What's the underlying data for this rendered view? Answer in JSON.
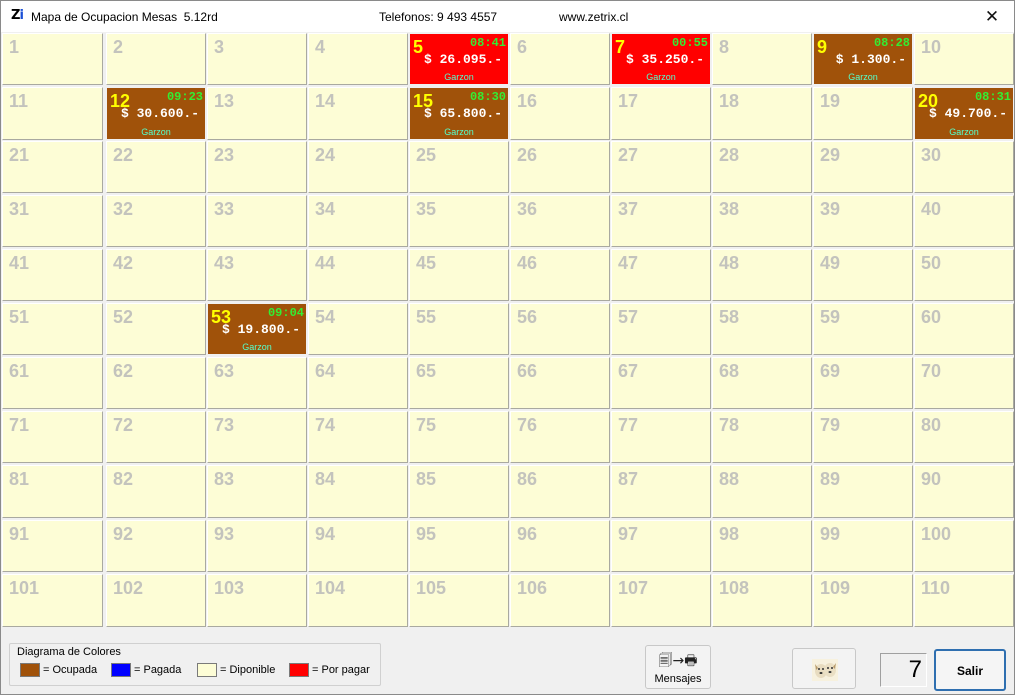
{
  "window": {
    "app_icon": "zi-logo-icon",
    "title": "Mapa de Ocupacion Mesas  5.12rd",
    "phones": "Telefonos: 9 493 4557",
    "website": "www.zetrix.cl",
    "close_glyph": "✕"
  },
  "tables": [
    {
      "num": "1"
    },
    {
      "num": "2"
    },
    {
      "num": "3"
    },
    {
      "num": "4"
    },
    {
      "num": "5",
      "status": "porpagar",
      "time": "08:41",
      "amount": "$ 26.095.-",
      "waiter": "Garzon"
    },
    {
      "num": "6"
    },
    {
      "num": "7",
      "status": "porpagar",
      "time": "00:55",
      "amount": "$ 35.250.-",
      "waiter": "Garzon"
    },
    {
      "num": "8"
    },
    {
      "num": "9",
      "status": "ocupada",
      "time": "08:28",
      "amount": "$ 1.300.-",
      "waiter": "Garzon"
    },
    {
      "num": "10"
    },
    {
      "num": "11"
    },
    {
      "num": "12",
      "status": "ocupada",
      "time": "09:23",
      "amount": "$ 30.600.-",
      "waiter": "Garzon"
    },
    {
      "num": "13"
    },
    {
      "num": "14"
    },
    {
      "num": "15",
      "status": "ocupada",
      "time": "08:30",
      "amount": "$ 65.800.-",
      "waiter": "Garzon"
    },
    {
      "num": "16"
    },
    {
      "num": "17"
    },
    {
      "num": "18"
    },
    {
      "num": "19"
    },
    {
      "num": "20",
      "status": "ocupada",
      "time": "08:31",
      "amount": "$ 49.700.-",
      "waiter": "Garzon"
    },
    {
      "num": "21"
    },
    {
      "num": "22"
    },
    {
      "num": "23"
    },
    {
      "num": "24"
    },
    {
      "num": "25"
    },
    {
      "num": "26"
    },
    {
      "num": "27"
    },
    {
      "num": "28"
    },
    {
      "num": "29"
    },
    {
      "num": "30"
    },
    {
      "num": "31"
    },
    {
      "num": "32"
    },
    {
      "num": "33"
    },
    {
      "num": "34"
    },
    {
      "num": "35"
    },
    {
      "num": "36"
    },
    {
      "num": "37"
    },
    {
      "num": "38"
    },
    {
      "num": "39"
    },
    {
      "num": "40"
    },
    {
      "num": "41"
    },
    {
      "num": "42"
    },
    {
      "num": "43"
    },
    {
      "num": "44"
    },
    {
      "num": "45"
    },
    {
      "num": "46"
    },
    {
      "num": "47"
    },
    {
      "num": "48"
    },
    {
      "num": "49"
    },
    {
      "num": "50"
    },
    {
      "num": "51"
    },
    {
      "num": "52"
    },
    {
      "num": "53",
      "status": "ocupada",
      "time": "09:04",
      "amount": "$ 19.800.-",
      "waiter": "Garzon"
    },
    {
      "num": "54"
    },
    {
      "num": "55"
    },
    {
      "num": "56"
    },
    {
      "num": "57"
    },
    {
      "num": "58"
    },
    {
      "num": "59"
    },
    {
      "num": "60"
    },
    {
      "num": "61"
    },
    {
      "num": "62"
    },
    {
      "num": "63"
    },
    {
      "num": "64"
    },
    {
      "num": "65"
    },
    {
      "num": "66"
    },
    {
      "num": "67"
    },
    {
      "num": "68"
    },
    {
      "num": "69"
    },
    {
      "num": "70"
    },
    {
      "num": "71"
    },
    {
      "num": "72"
    },
    {
      "num": "73"
    },
    {
      "num": "74"
    },
    {
      "num": "75"
    },
    {
      "num": "76"
    },
    {
      "num": "77"
    },
    {
      "num": "78"
    },
    {
      "num": "79"
    },
    {
      "num": "80"
    },
    {
      "num": "81"
    },
    {
      "num": "82"
    },
    {
      "num": "83"
    },
    {
      "num": "84"
    },
    {
      "num": "85"
    },
    {
      "num": "86"
    },
    {
      "num": "87"
    },
    {
      "num": "88"
    },
    {
      "num": "89"
    },
    {
      "num": "90"
    },
    {
      "num": "91"
    },
    {
      "num": "92"
    },
    {
      "num": "93"
    },
    {
      "num": "94"
    },
    {
      "num": "95"
    },
    {
      "num": "96"
    },
    {
      "num": "97"
    },
    {
      "num": "98"
    },
    {
      "num": "99"
    },
    {
      "num": "100"
    },
    {
      "num": "101"
    },
    {
      "num": "102"
    },
    {
      "num": "103"
    },
    {
      "num": "104"
    },
    {
      "num": "105"
    },
    {
      "num": "106"
    },
    {
      "num": "107"
    },
    {
      "num": "108"
    },
    {
      "num": "109"
    },
    {
      "num": "110"
    }
  ],
  "legend": {
    "title": "Diagrama de Colores",
    "items": [
      {
        "label": "= Ocupada",
        "color": "#a0520a"
      },
      {
        "label": "= Pagada",
        "color": "#0000ff"
      },
      {
        "label": "= Diponible",
        "color": "#fdfdd6"
      },
      {
        "label": "= Por pagar",
        "color": "#ff0000"
      }
    ]
  },
  "toolbar": {
    "mensajes_icon": "copy-to-printer-icon",
    "mensajes_glyph": "🗐→🖶",
    "mensajes_label": "Mensajes",
    "picture_button_icon": "dogs-picture-icon",
    "counter_value": "7",
    "salir_label": "Salir"
  },
  "colors": {
    "available": "#fdfdd6",
    "ocupada": "#a0520a",
    "por_pagar": "#ff0000",
    "pagada": "#0000ff",
    "table_number_active": "#ffff00",
    "time_text": "#33ee33",
    "waiter_text": "#55ffcc"
  }
}
